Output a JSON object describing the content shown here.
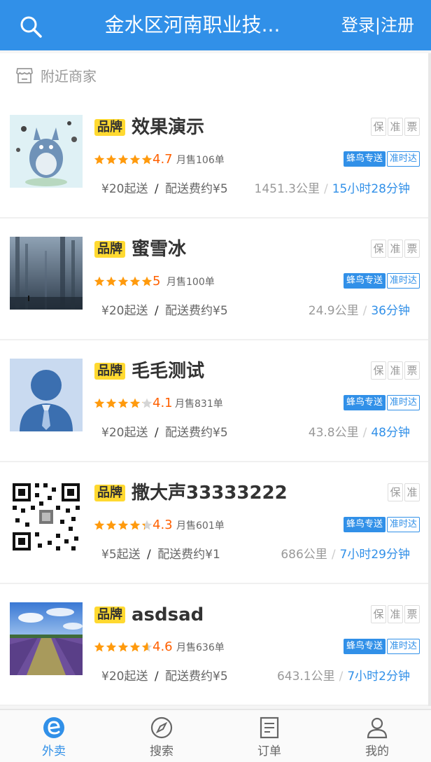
{
  "header": {
    "title": "金水区河南职业技...",
    "login_label": "登录|注册"
  },
  "section": {
    "label": "附近商家"
  },
  "shops": [
    {
      "brand": "品牌",
      "name": "效果演示",
      "tags": [
        "保",
        "准",
        "票"
      ],
      "stars": 5,
      "rating": "4.7",
      "sales": "月售106单",
      "delivery_fn": "蜂鸟专送",
      "delivery_zs": "准时达",
      "min_order": "¥20起送",
      "fee_sep": "/",
      "fee": "配送费约¥5",
      "distance": "1451.3公里",
      "dist_sep": "/",
      "time": "15小时28分钟"
    },
    {
      "brand": "品牌",
      "name": "蜜雪冰",
      "tags": [
        "保",
        "准",
        "票"
      ],
      "stars": 5,
      "rating": "5",
      "sales": "月售100单",
      "delivery_fn": "蜂鸟专送",
      "delivery_zs": "准时达",
      "min_order": "¥20起送",
      "fee_sep": "/",
      "fee": "配送费约¥5",
      "distance": "24.9公里",
      "dist_sep": "/",
      "time": "36分钟"
    },
    {
      "brand": "品牌",
      "name": "毛毛测试",
      "tags": [
        "保",
        "准",
        "票"
      ],
      "stars": 4.1,
      "rating": "4.1",
      "sales": "月售831单",
      "delivery_fn": "蜂鸟专送",
      "delivery_zs": "准时达",
      "min_order": "¥20起送",
      "fee_sep": "/",
      "fee": "配送费约¥5",
      "distance": "43.8公里",
      "dist_sep": "/",
      "time": "48分钟"
    },
    {
      "brand": "品牌",
      "name": "撒大声33333222",
      "tags": [
        "保",
        "准"
      ],
      "stars": 4.3,
      "rating": "4.3",
      "sales": "月售601单",
      "delivery_fn": "蜂鸟专送",
      "delivery_zs": "准时达",
      "min_order": "¥5起送",
      "fee_sep": "/",
      "fee": "配送费约¥1",
      "distance": "686公里",
      "dist_sep": "/",
      "time": "7小时29分钟"
    },
    {
      "brand": "品牌",
      "name": "asdsad",
      "tags": [
        "保",
        "准",
        "票"
      ],
      "stars": 4.6,
      "rating": "4.6",
      "sales": "月售636单",
      "delivery_fn": "蜂鸟专送",
      "delivery_zs": "准时达",
      "min_order": "¥20起送",
      "fee_sep": "/",
      "fee": "配送费约¥5",
      "distance": "643.1公里",
      "dist_sep": "/",
      "time": "7小时2分钟"
    }
  ],
  "tabbar": [
    {
      "label": "外卖",
      "icon": "takeout-icon"
    },
    {
      "label": "搜索",
      "icon": "compass-icon"
    },
    {
      "label": "订单",
      "icon": "order-icon"
    },
    {
      "label": "我的",
      "icon": "user-icon"
    }
  ],
  "colors": {
    "primary": "#3190e8",
    "rating": "#ff6000",
    "star": "#ff9a0d",
    "brand_bg": "#ffd930"
  }
}
